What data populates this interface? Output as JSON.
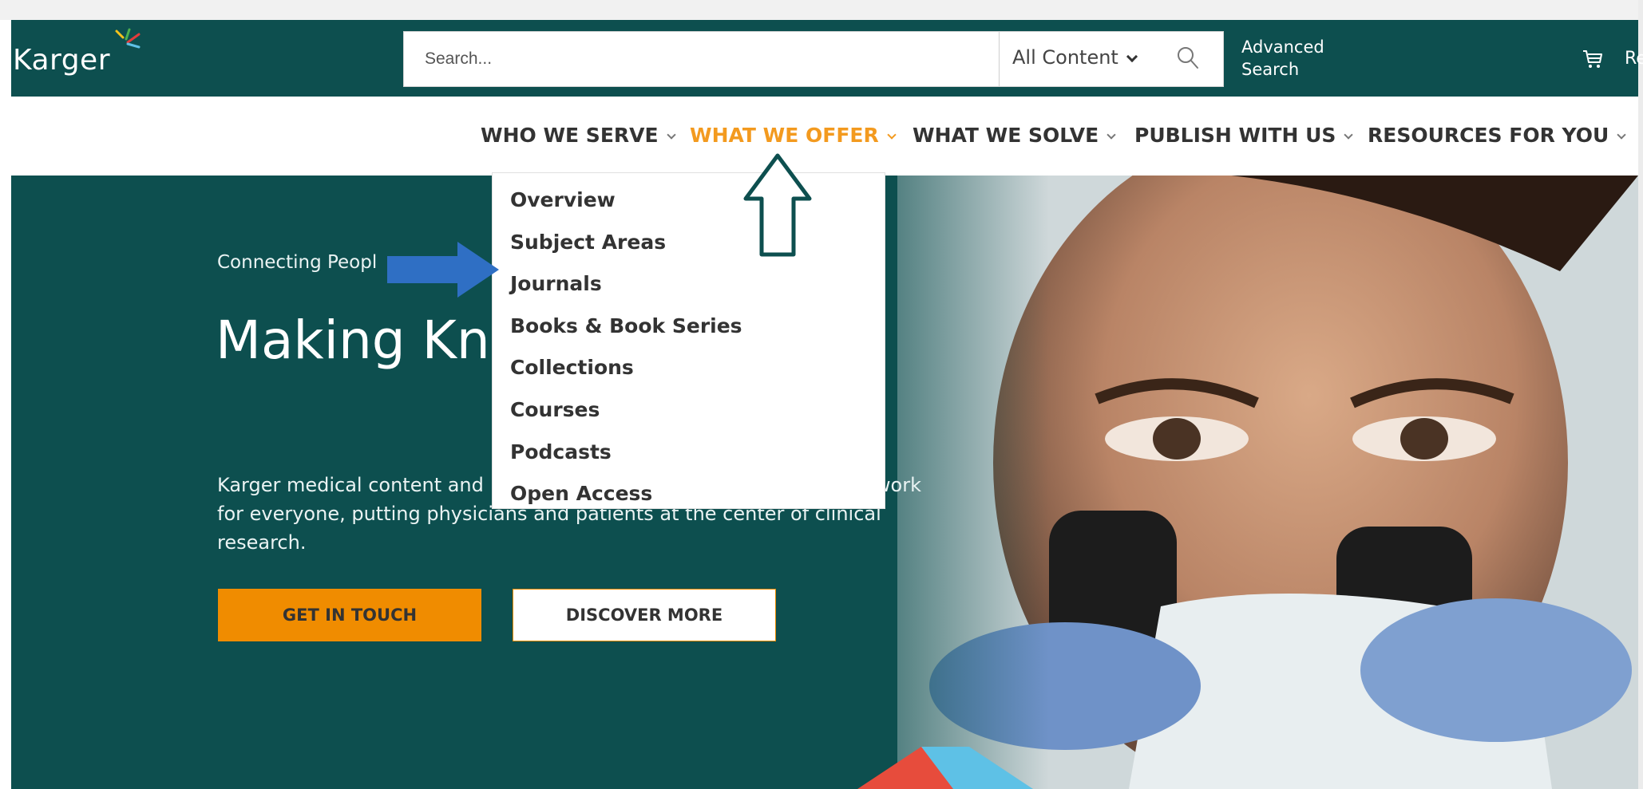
{
  "header": {
    "logo": "Karger",
    "search": {
      "placeholder": "Search..."
    },
    "content_filter": "All Content",
    "advanced_search": [
      "Advanced",
      "Search"
    ],
    "register_clipped": "Re"
  },
  "nav": {
    "items": [
      {
        "label": "WHO WE SERVE",
        "active": false
      },
      {
        "label": "WHAT WE OFFER",
        "active": true
      },
      {
        "label": "WHAT WE SOLVE",
        "active": false
      },
      {
        "label": "PUBLISH WITH US",
        "active": false
      },
      {
        "label": "RESOURCES FOR YOU",
        "active": false
      }
    ]
  },
  "dropdown": {
    "items": [
      "Overview",
      "Subject Areas",
      "Journals",
      "Books & Book Series",
      "Collections",
      "Courses",
      "Podcasts",
      "Open Access"
    ]
  },
  "hero": {
    "subtitle": "Connecting Peopl",
    "title": "Making Kn",
    "body_line1_start": "Karger medical content and",
    "body_line1_end": "work",
    "body_line2": "for everyone, putting physicians and patients at the center of clinical",
    "body_line3": "research.",
    "buttons": {
      "get_in_touch": "GET IN TOUCH",
      "discover_more": "DISCOVER MORE"
    }
  },
  "colors": {
    "brand_teal": "#0d4f4f",
    "accent_orange": "#f39a1f",
    "button_orange": "#f08c00",
    "annotation_blue": "#2f6fc4"
  },
  "icons": [
    "karger-logo-mark",
    "chevron-down-icon",
    "search-icon",
    "cart-icon",
    "arrow-right-annotation",
    "arrow-up-annotation"
  ]
}
